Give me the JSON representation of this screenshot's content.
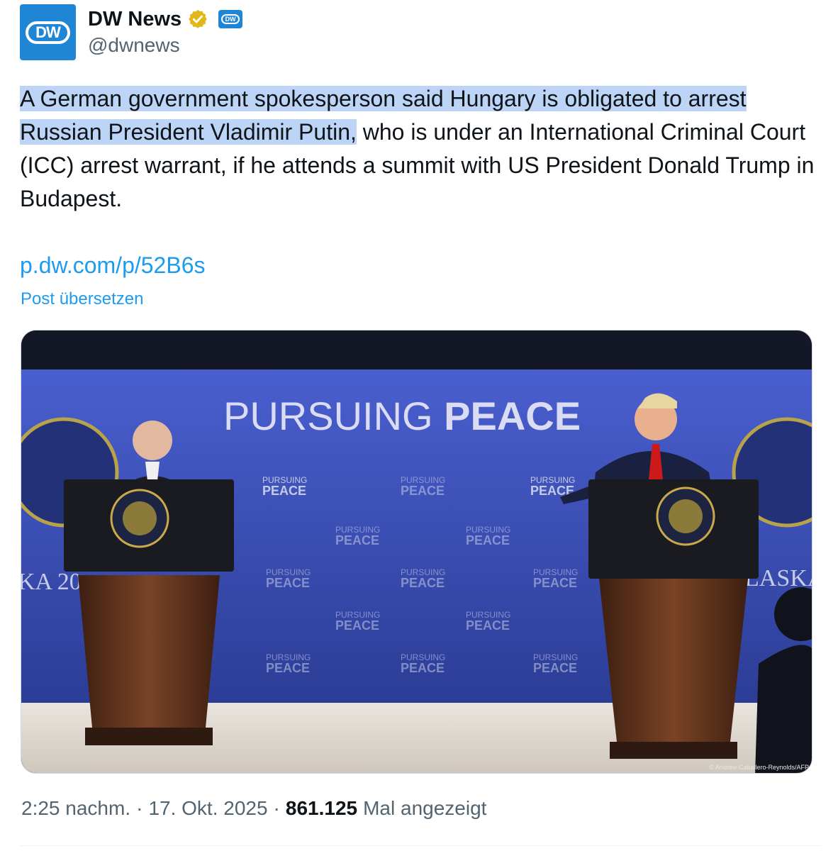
{
  "account": {
    "display_name": "DW News",
    "handle": "@dwnews",
    "avatar_text": "DW",
    "affiliate_badge_text": "DW"
  },
  "tweet": {
    "text_highlighted": "A German government spokesperson said Hungary is obligated to arrest Russian President Vladimir Putin,",
    "text_rest": " who is under an International Criminal Court (ICC) arrest warrant, if he attends a summit with US President Donald Trump in Budapest.",
    "link": "p.dw.com/p/52B6s",
    "translate_label": "Post übersetzen"
  },
  "media": {
    "backdrop_headline_light": "PURSUING ",
    "backdrop_headline_bold": "PEACE",
    "backdrop_small_top": "PURSUING",
    "backdrop_small_bottom": "PEACE",
    "left_partial_text": "KA 20",
    "right_partial_text": "LASKA",
    "credit": "© Andrew Caballero-Reynolds/AFP"
  },
  "meta": {
    "time": "2:25 nachm.",
    "sep1": "·",
    "date": "17. Okt. 2025",
    "sep2": "·",
    "views_count": "861.125",
    "views_label": "Mal angezeigt"
  },
  "colors": {
    "link_blue": "#1d9bf0",
    "dw_blue": "#1f86d6",
    "verified_gold": "#e2b719",
    "highlight": "#bcd4f6",
    "backdrop_blue": "#3a4fb8"
  }
}
